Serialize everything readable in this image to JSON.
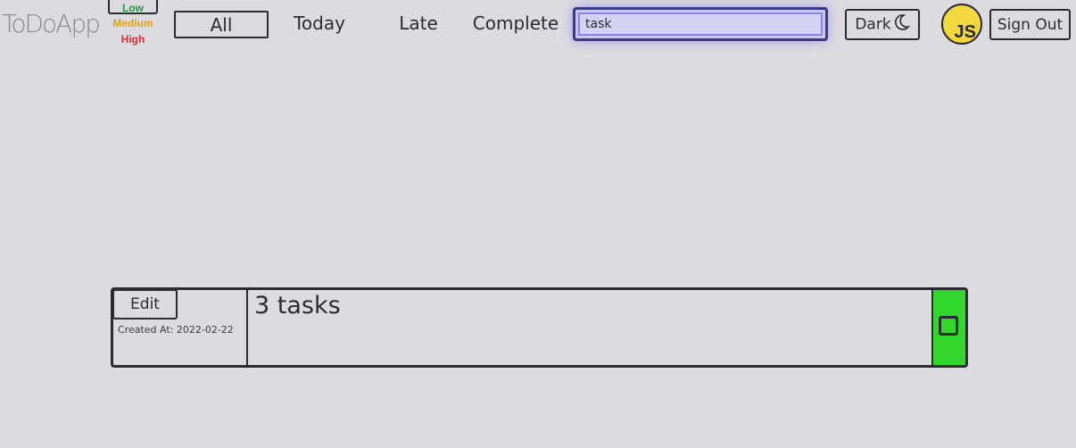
{
  "app": {
    "logo": "ToDoApp"
  },
  "priority": {
    "low": "Low",
    "medium": "Medium",
    "high": "High"
  },
  "tabs": [
    {
      "label": "All",
      "active": true
    },
    {
      "label": "Today",
      "active": false
    },
    {
      "label": "Late",
      "active": false
    },
    {
      "label": "Complete",
      "active": false
    }
  ],
  "search": {
    "value": "task"
  },
  "header": {
    "dark_label": "Dark",
    "dark_icon": "moon-icon",
    "avatar_initials": "JS",
    "signout_label": "Sign Out"
  },
  "tasks": [
    {
      "edit_label": "Edit",
      "created": "Created At: 2022-02-22",
      "title": "3 tasks",
      "complete_color": "#34d72c"
    }
  ],
  "colors": {
    "low": "#1d9a3a",
    "medium": "#e2a417",
    "high": "#e02b2b",
    "search_glow": "#8a86e8",
    "avatar": "#f1d83f"
  }
}
